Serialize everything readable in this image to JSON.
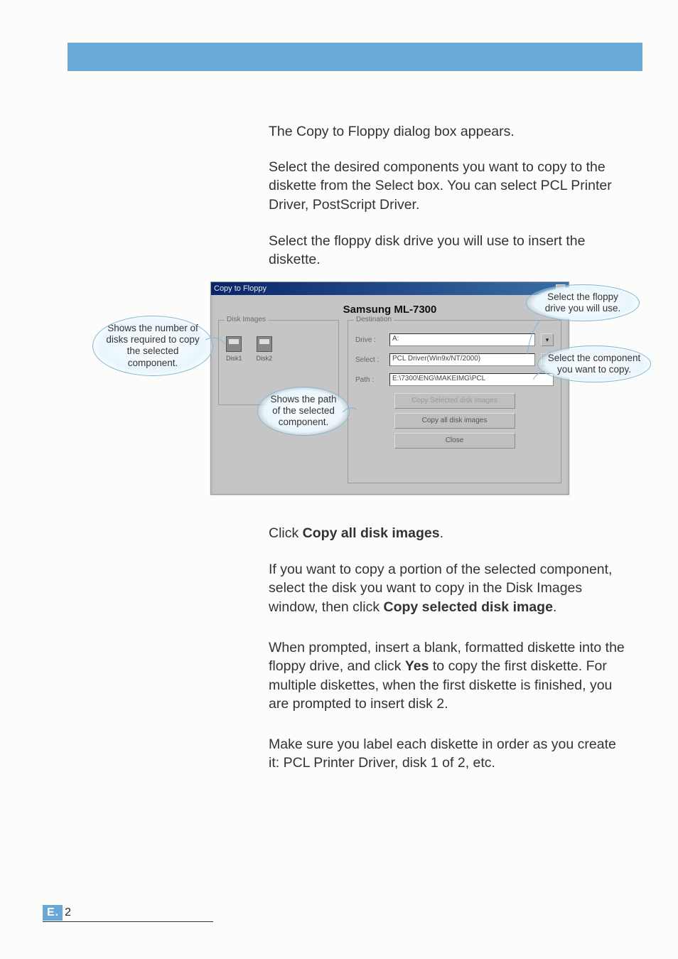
{
  "paragraphs": {
    "intro": "The Copy to Floppy dialog box appears.",
    "select_components": "Select the desired components you want to copy to the diskette from the Select box. You can select PCL Printer Driver, PostScript Driver.",
    "select_drive": "Select the floppy disk drive you will use to insert the diskette.",
    "click_copy_all_pre": "Click ",
    "click_copy_all_bold": "Copy all disk images",
    "click_copy_all_post": ".",
    "portion_pre": "If you want to copy a portion of the selected component, select the disk you want to copy in the Disk Images window, then click ",
    "portion_bold": "Copy selected disk image",
    "portion_post": ".",
    "prompt_pre": "When prompted, insert a blank, formatted diskette into the floppy drive, and click ",
    "prompt_bold": "Yes",
    "prompt_post": " to copy the first diskette. For multiple diskettes, when the first diskette is finished, you are prompted to insert disk 2.",
    "label_note": "Make sure you label each diskette in order as you create it: PCL Printer Driver, disk 1 of 2, etc."
  },
  "callouts": {
    "disks": "Shows the number of disks required to copy the selected component.",
    "path": "Shows the path of the selected component.",
    "drive": "Select the floppy drive you will use.",
    "component": "Select the component you want to copy."
  },
  "dialog": {
    "title": "Copy to Floppy",
    "product": "Samsung ML-7300",
    "disk_images_legend": "Disk Images",
    "disk1": "Disk1",
    "disk2": "Disk2",
    "destination_legend": "Destination",
    "drive_label": "Drive :",
    "drive_value": "A:",
    "select_label": "Select :",
    "select_value": "PCL Driver(Win9x/NT/2000)",
    "path_label": "Path :",
    "path_value": "E:\\7300\\ENG\\MAKEIMG\\PCL",
    "btn_copy_selected": "Copy Selected disk images",
    "btn_copy_all": "Copy all disk images",
    "btn_close": "Close"
  },
  "footer": {
    "section": "E.",
    "page": "2"
  }
}
